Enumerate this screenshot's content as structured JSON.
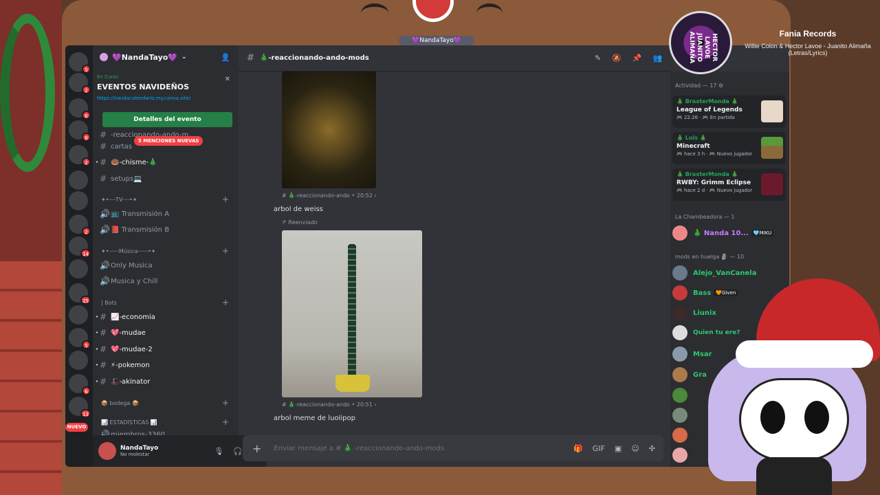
{
  "stream": {
    "bear_label": "💜NandaTayo💜"
  },
  "now_playing": {
    "title": "Fania Records",
    "subtitle": "Willie Colon & Hector Lavoe - Juanito Alimaña (Letras/Lyrics)",
    "disc_text": "HECTOR LAVOE JUANITO ALIMAÑA"
  },
  "servers": [
    {
      "icon": "discord-home-icon",
      "badge": "5"
    },
    {
      "icon": "avatar",
      "badge": "2"
    },
    {
      "icon": "avatar",
      "badge": "6"
    },
    {
      "icon": "avatar",
      "badge": "8"
    },
    {
      "icon": "avatar",
      "badge": "2"
    },
    {
      "icon": "diamond-icon",
      "badge": ""
    },
    {
      "icon": "podcast-icon",
      "badge": ""
    },
    {
      "icon": "avatar",
      "badge": "2"
    },
    {
      "icon": "avatar",
      "badge": "14"
    },
    {
      "icon": "kick-icon",
      "badge": ""
    },
    {
      "icon": "avatar",
      "badge": "25"
    },
    {
      "icon": "avatar",
      "badge": ""
    },
    {
      "icon": "avatar",
      "badge": "5"
    },
    {
      "icon": "twitch-icon",
      "badge": ""
    },
    {
      "icon": "avatar",
      "badge": "6"
    },
    {
      "icon": "avatar",
      "badge": "13"
    }
  ],
  "nuevo": "NUEVO",
  "guild": {
    "name": "💜NandaTayo💜"
  },
  "event": {
    "status": "En Curso",
    "title": "EVENTOS NAVIDEÑOS",
    "link": "https://nandacalendario.my.canva.site/",
    "button": "Detalles del evento"
  },
  "mentions_badge": "5 MENCIONES NUEVAS",
  "channel_list": {
    "partial": "-reaccionando-ando-m...",
    "cartas": "cartas",
    "chisme": "🍩-chisme-🎄",
    "setups": "setups💻",
    "tv_cat": "✦•┈┈TV┈┈•✦",
    "trans_a": "📺 Transmisión A",
    "trans_b": "📕 Transmisión B",
    "music_cat": "✦•┈┈┈Música┈┈┈•✦",
    "only_musica": "Only Musica",
    "musica_chill": "Musica y Chill",
    "bots_cat": "| Bots",
    "economia": "📈-economia",
    "mudae": "💖-mudae",
    "mudae2": "💖-mudae-2",
    "pokemon": "⚡-pokemon",
    "akinator": "🎩-akinator",
    "bodega": "📦 bodega 📦",
    "estadisticas": "📊 ESTADÍSTICAS 📊",
    "miembros": "miembros-3360"
  },
  "user": {
    "name": "NandaTayo",
    "status": "No molestar"
  },
  "chat": {
    "channel": "🎄-reaccionando-ando-mods",
    "msg1_meta": "# 🎄-reaccionando-ando • 20:52 ›",
    "msg1_text": "arbol de weiss",
    "forwarded": "↱ Reenviado",
    "msg2_meta": "# 🎄-reaccionando-ando • 20:51 ›",
    "msg2_text": "arbol meme de luolipop",
    "composer_placeholder": "Enviar mensaje a # 🎄 -reaccionando-ando-mods"
  },
  "members": {
    "activity_header": "Actividad — 17 ⚙",
    "activities": [
      {
        "name": "🎄 BraxterMonda 🎄",
        "game": "League of Legends",
        "detail": "🎮 22:26 · 🎮 En partida"
      },
      {
        "name": "🎄 Luis 🎄",
        "game": "Minecraft",
        "detail": "🎮 hace 3 h · 🎮 Nuevo jugador"
      },
      {
        "name": "🎄 BraxterMonda 🎄",
        "game": "RWBY: Grimm Eclipse",
        "detail": "🎮 hace 2 d · 🎮 Nuevo jugador"
      }
    ],
    "chambeadora_header": "La Chambeadora — 1",
    "chambeadora": [
      {
        "name": "🎄 Nanda 10...",
        "tag": "🩵MIKU",
        "color": "#c57cff"
      }
    ],
    "mods_header": "mods en huelga 🗿 — 10",
    "mods": [
      {
        "name": "Alejo_VanCanela",
        "color": "#2dc770"
      },
      {
        "name": "Bass",
        "tag": "🧡Given",
        "color": "#2dc770"
      },
      {
        "name": "Liunix",
        "color": "#2dc770"
      },
      {
        "name": "Quien tu ere?",
        "color": "#2dc770"
      },
      {
        "name": "Msar",
        "color": "#2dc770"
      },
      {
        "name": "Gra",
        "color": "#2dc770"
      },
      {
        "name": "",
        "color": "#2dc770"
      },
      {
        "name": "",
        "color": "#2dc770"
      },
      {
        "name": "",
        "color": "#2dc770"
      },
      {
        "name": "",
        "color": "#2dc770"
      }
    ]
  },
  "colors": {
    "accent_green": "#248046",
    "danger_red": "#f23f43",
    "link_blue": "#00a8fc",
    "mod_green": "#2dc770"
  }
}
